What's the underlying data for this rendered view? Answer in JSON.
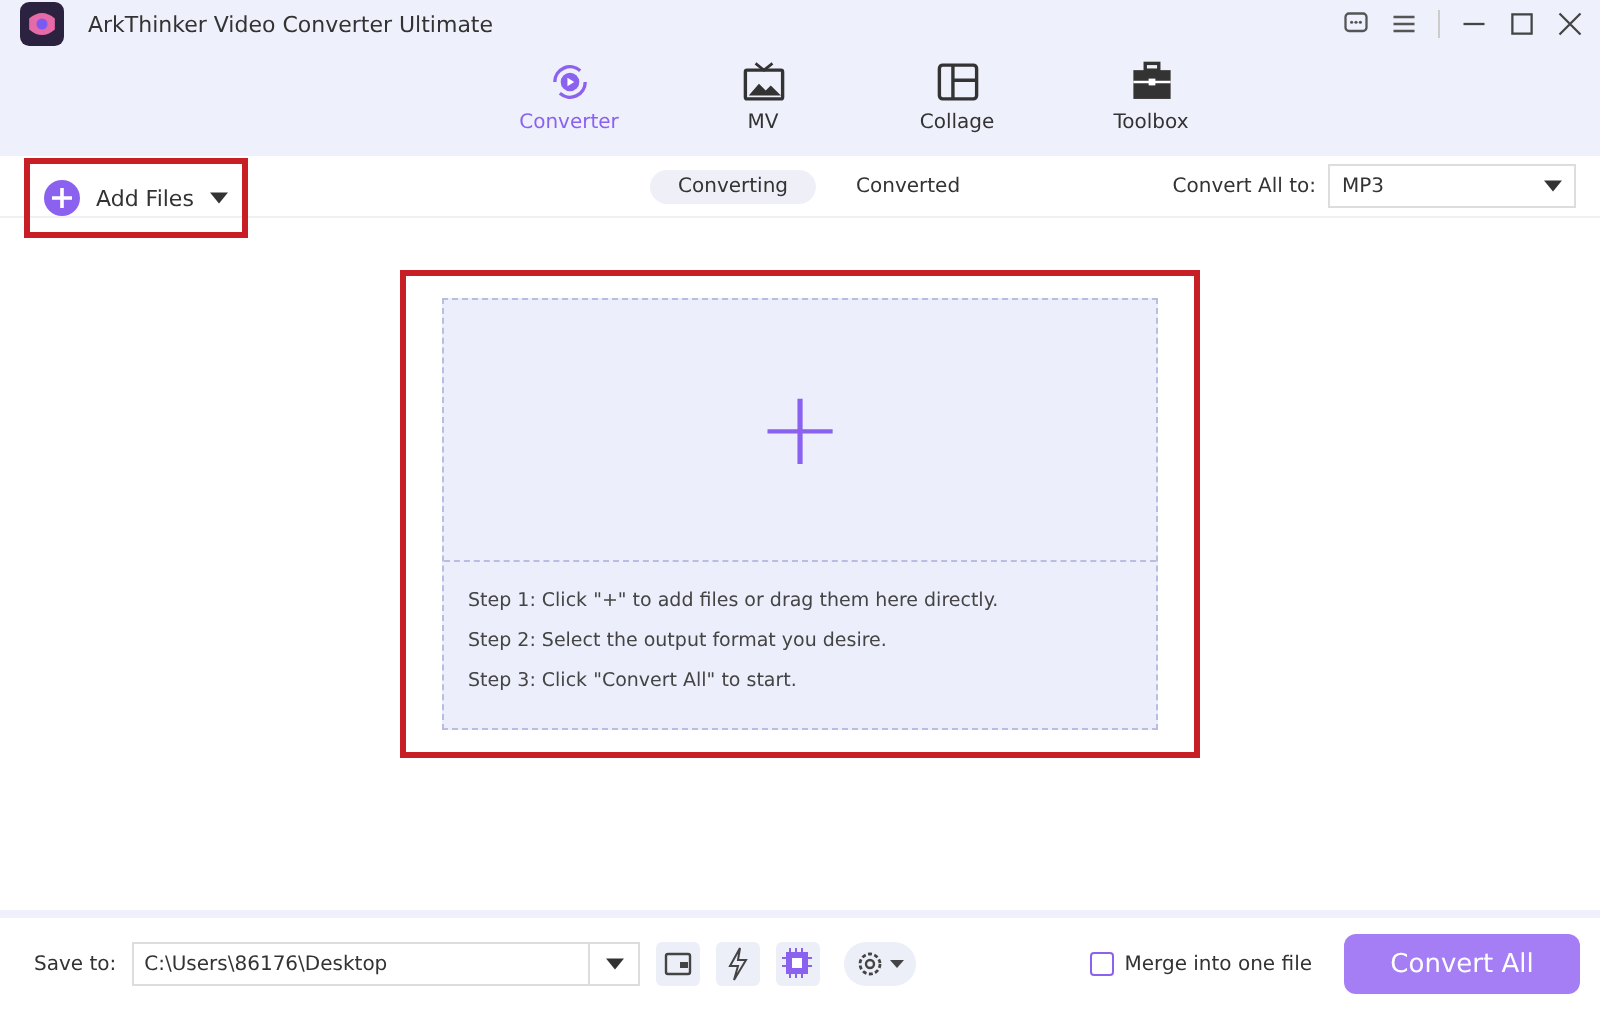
{
  "window": {
    "title": "ArkThinker Video Converter Ultimate"
  },
  "nav_tabs": [
    {
      "label": "Converter",
      "kind": "converter",
      "selected": true
    },
    {
      "label": "MV",
      "kind": "mv",
      "selected": false
    },
    {
      "label": "Collage",
      "kind": "collage",
      "selected": false
    },
    {
      "label": "Toolbox",
      "kind": "toolbox",
      "selected": false
    }
  ],
  "toolbar": {
    "add_files": "Add Files",
    "tabs": [
      {
        "label": "Converting",
        "selected": true
      },
      {
        "label": "Converted",
        "selected": false
      }
    ],
    "convert_all_label": "Convert All to:",
    "format": "MP3"
  },
  "drop_zone": {
    "plus": "+",
    "steps": [
      "Step 1: Click \"+\" to add files or drag them here directly.",
      "Step 2: Select the output format you desire.",
      "Step 3: Click \"Convert All\" to start."
    ]
  },
  "footer": {
    "save_label": "Save to:",
    "save_path": "C:\\Users\\86176\\Desktop",
    "merge": {
      "label": "Merge into one file",
      "checked": false
    },
    "convert_button": "Convert All"
  }
}
